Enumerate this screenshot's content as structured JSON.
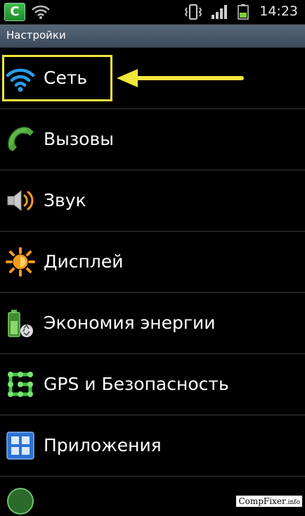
{
  "status_bar": {
    "app_icon_letter": "C",
    "time": "14:23",
    "icons": [
      "wifi-icon",
      "vibrate-icon",
      "signal-icon",
      "battery-icon"
    ]
  },
  "title_bar": {
    "title": "Настройки"
  },
  "settings": {
    "items": [
      {
        "label": "Сеть",
        "icon": "wifi-icon"
      },
      {
        "label": "Вызовы",
        "icon": "phone-icon"
      },
      {
        "label": "Звук",
        "icon": "speaker-icon"
      },
      {
        "label": "Дисплей",
        "icon": "brightness-icon"
      },
      {
        "label": "Экономия энергии",
        "icon": "battery-saver-icon"
      },
      {
        "label": "GPS и Безопасность",
        "icon": "security-pattern-icon"
      },
      {
        "label": "Приложения",
        "icon": "apps-grid-icon"
      }
    ]
  },
  "colors": {
    "highlight": "#f1e63c",
    "title_bar": "#4a5a6c",
    "wifi_blue": "#2a9ce8"
  },
  "watermark": {
    "text": "CompFixer",
    "suffix": ".info"
  }
}
